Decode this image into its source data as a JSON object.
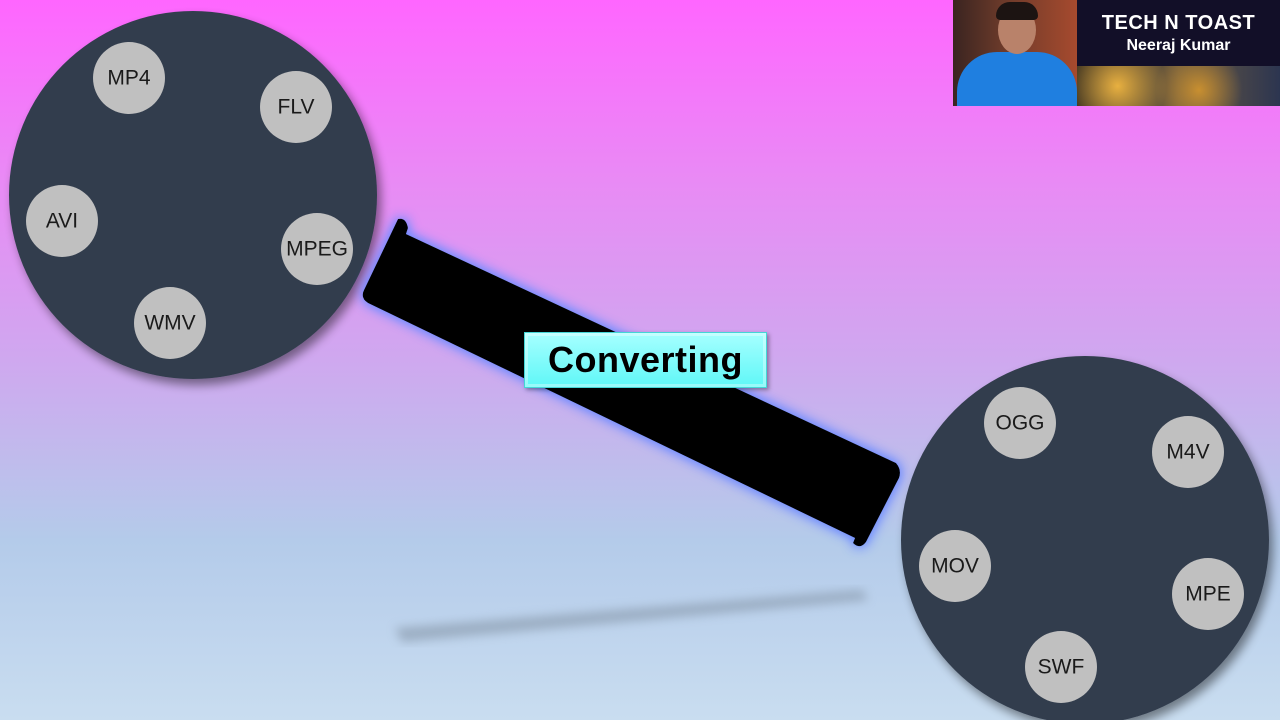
{
  "slide": {
    "center_label": "Converting",
    "source_formats": [
      "MP4",
      "FLV",
      "AVI",
      "MPEG",
      "WMV"
    ],
    "target_formats": [
      "OGG",
      "M4V",
      "MOV",
      "MPE",
      "SWF"
    ]
  },
  "branding": {
    "title": "TECH N TOAST",
    "presenter": "Neeraj Kumar"
  },
  "colors": {
    "wheel": "#333d4e",
    "format_badge": "#c0c0c0",
    "band": "#000000",
    "band_glow": "#6f8cff",
    "label_bg": "#7ffcfc"
  }
}
